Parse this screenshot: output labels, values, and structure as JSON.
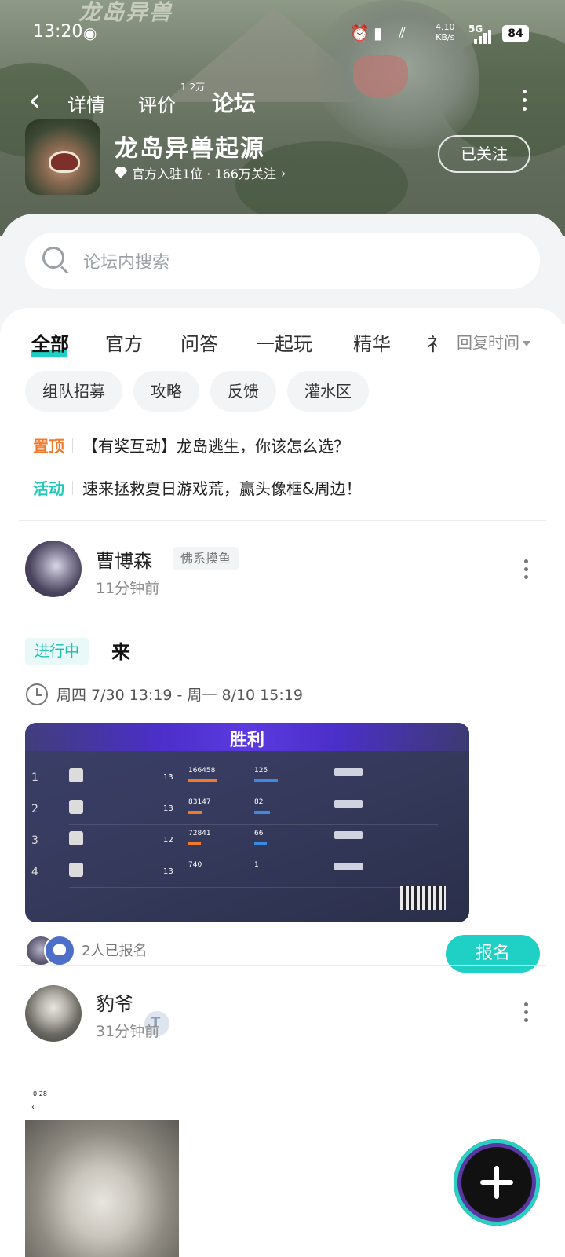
{
  "status_bar": {
    "time": "13:20",
    "speed_value": "4.10",
    "speed_unit": "KB/s",
    "network": "5G",
    "battery": "84"
  },
  "nav": {
    "tabs": [
      {
        "label": "详情"
      },
      {
        "label": "评价",
        "badge": "1.2万"
      },
      {
        "label": "论坛"
      }
    ],
    "active_tab": "论坛"
  },
  "game": {
    "name": "龙岛异兽起源",
    "meta": "官方入驻1位 · 166万关注",
    "follow_label": "已关注",
    "hero_logo": "龙岛异兽"
  },
  "search": {
    "placeholder": "论坛内搜索"
  },
  "categories": {
    "items": [
      {
        "label": "全部"
      },
      {
        "label": "官方"
      },
      {
        "label": "问答"
      },
      {
        "label": "一起玩"
      },
      {
        "label": "精华"
      },
      {
        "label": "礻"
      }
    ],
    "active": "全部",
    "sort_label": "回复时间"
  },
  "chips": [
    {
      "label": "组队招募"
    },
    {
      "label": "攻略"
    },
    {
      "label": "反馈"
    },
    {
      "label": "灌水区"
    }
  ],
  "notices": [
    {
      "tag": "置顶",
      "text": "【有奖互动】龙岛逃生，你该怎么选？",
      "color": "#f07a2c"
    },
    {
      "tag": "活动",
      "text": "速来拯救夏日游戏荒，赢头像框&周边！",
      "color": "#1fc8bb"
    }
  ],
  "posts": [
    {
      "username": "曹博森",
      "user_tag": "佛系摸鱼",
      "time": "11分钟前",
      "status": "进行中",
      "title": "来",
      "schedule": "周四 7/30 13:19 - 周一 8/10 15:19",
      "screenshot": {
        "title": "胜利",
        "rows": [
          {
            "rank": "1",
            "level": "13",
            "score": "166458",
            "kills": "125",
            "score_pct": 0.36,
            "kills_pct": 0.5
          },
          {
            "rank": "2",
            "level": "13",
            "score": "83147",
            "kills": "82",
            "score_pct": 0.18,
            "kills_pct": 0.33
          },
          {
            "rank": "3",
            "level": "12",
            "score": "72841",
            "kills": "66",
            "score_pct": 0.16,
            "kills_pct": 0.26
          },
          {
            "rank": "4",
            "level": "13",
            "score": "740",
            "kills": "1",
            "score_pct": 0.0,
            "kills_pct": 0.0
          }
        ]
      },
      "signup_count": "2人已报名",
      "signup_label": "报名"
    },
    {
      "username": "豹爷",
      "time": "31分钟前",
      "mini_status": "0:28"
    }
  ],
  "colors": {
    "accent": "#1fd1c4",
    "pinned": "#f07a2c",
    "activity": "#1fc8bb"
  }
}
